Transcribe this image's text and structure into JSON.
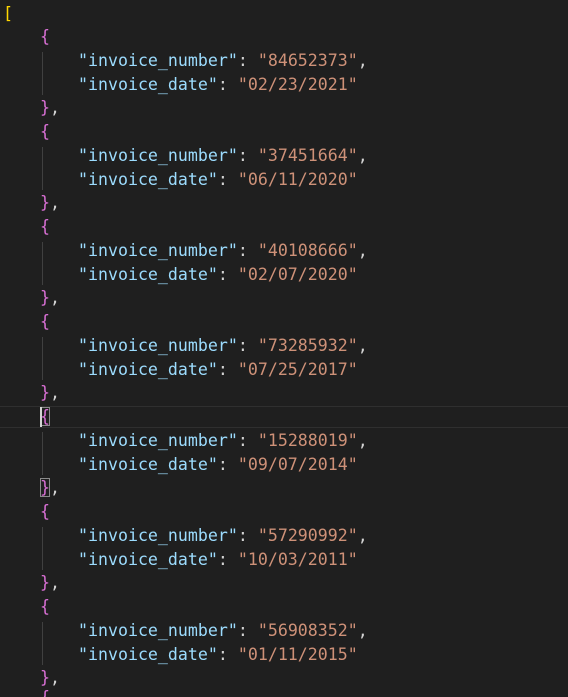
{
  "editor": {
    "open_bracket": "[",
    "open_brace": "{",
    "close_brace": "},",
    "colon": ": ",
    "comma": ",",
    "key_invoice_number": "\"invoice_number\"",
    "key_invoice_date": "\"invoice_date\"",
    "records": [
      {
        "invoice_number": "\"84652373\"",
        "invoice_date": "\"02/23/2021\""
      },
      {
        "invoice_number": "\"37451664\"",
        "invoice_date": "\"06/11/2020\""
      },
      {
        "invoice_number": "\"40108666\"",
        "invoice_date": "\"02/07/2020\""
      },
      {
        "invoice_number": "\"73285932\"",
        "invoice_date": "\"07/25/2017\""
      },
      {
        "invoice_number": "\"15288019\"",
        "invoice_date": "\"09/07/2014\""
      },
      {
        "invoice_number": "\"57290992\"",
        "invoice_date": "\"10/03/2011\""
      },
      {
        "invoice_number": "\"56908352\"",
        "invoice_date": "\"01/11/2015\""
      }
    ],
    "colors": {
      "background": "#1f1f1f",
      "outer_bracket": "#ffd700",
      "brace": "#da70d6",
      "key": "#9cdcfe",
      "string": "#ce9178",
      "punctuation": "#d4d4d4"
    }
  }
}
